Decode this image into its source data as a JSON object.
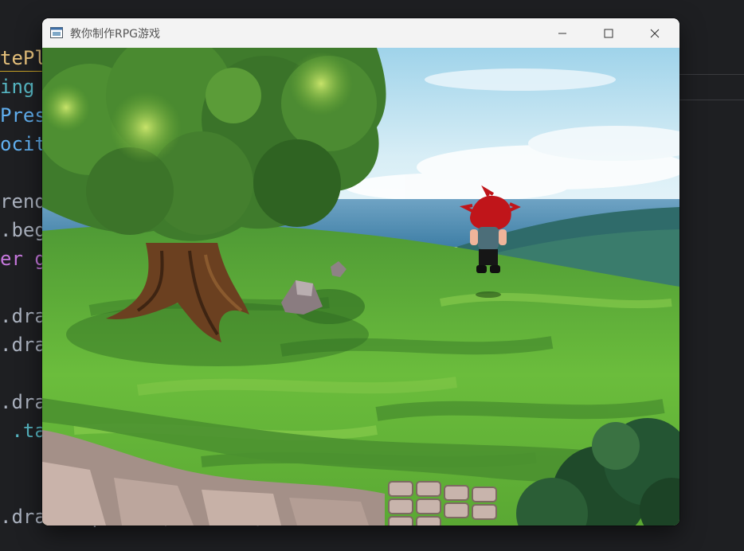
{
  "editor": {
    "lines": [
      {
        "text": "tePl",
        "color": "#e5c07b"
      },
      {
        "text": "ing ",
        "color": "#56b6c2"
      },
      {
        "text": "Pres",
        "color": "#61afef"
      },
      {
        "text": "ocit",
        "color": "#61afef"
      },
      {
        "text": "",
        "color": "#abb2bf"
      },
      {
        "text": "rend",
        "color": "#abb2bf"
      },
      {
        "text": ".beg",
        "color": "#abb2bf"
      },
      {
        "text": "er g",
        "color": "#c678dd"
      },
      {
        "text": "",
        "color": "#abb2bf"
      },
      {
        "text": ".dra",
        "color": "#abb2bf"
      },
      {
        "text": ".dra",
        "color": "#abb2bf"
      },
      {
        "text": "",
        "color": "#abb2bf"
      },
      {
        "text": ".dra",
        "color": "#abb2bf"
      },
      {
        "text": " .ta",
        "color": "#56b6c2"
      },
      {
        "text": "",
        "color": "#abb2bf"
      },
      {
        "text": "",
        "color": "#abb2bf"
      },
      {
        "text": ".draw(mapShade, .zero);",
        "color": "#abb2bf"
      }
    ]
  },
  "window": {
    "title": "教你制作RPG游戏",
    "icon": "app-window-icon",
    "controls": {
      "minimize_icon": "minimize-icon",
      "maximize_icon": "maximize-icon",
      "close_icon": "close-icon"
    }
  },
  "game": {
    "scene": "hilltop-overlook",
    "elements": [
      "large-tree",
      "rocks",
      "player-character",
      "distant-mountains",
      "sea",
      "sky",
      "stone-cliff",
      "bushes"
    ],
    "colors": {
      "sky": "#bfe3f2",
      "grass": "#5fae3a",
      "tree_leaves": "#4f8f2e",
      "trunk": "#6b4020",
      "hair": "#c0151a"
    }
  }
}
